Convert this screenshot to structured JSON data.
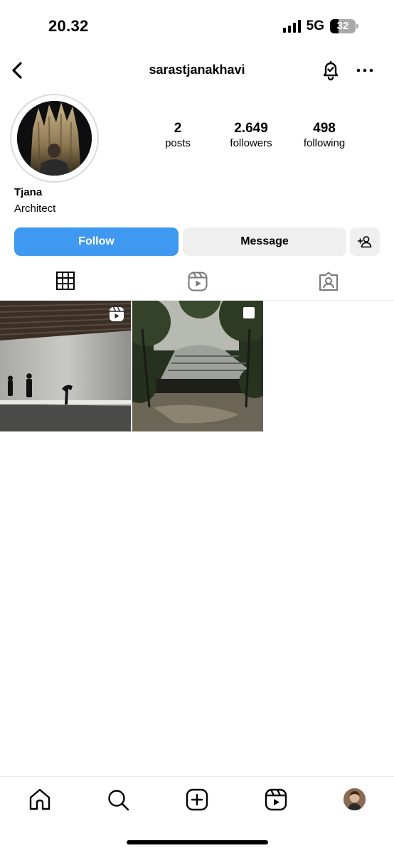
{
  "status_bar": {
    "time": "20.32",
    "network": "5G",
    "battery_level": "32",
    "battery_fraction": 0.32,
    "signal_bars": 4
  },
  "nav": {
    "username": "sarastjanakhavi",
    "back_icon": "chevron-left-icon",
    "bell_icon": "bell-check-icon",
    "more_icon": "more-horizontal-icon"
  },
  "profile": {
    "stats": [
      {
        "value": "2",
        "label": "posts"
      },
      {
        "value": "2.649",
        "label": "followers"
      },
      {
        "value": "498",
        "label": "following"
      }
    ],
    "name": "Tjana",
    "bio": "Architect"
  },
  "actions": {
    "follow_label": "Follow",
    "message_label": "Message",
    "add_user_icon": "add-user-icon",
    "follow_color": "#4099f0"
  },
  "tabs": [
    {
      "icon": "grid-icon",
      "active": true
    },
    {
      "icon": "reels-icon",
      "active": false
    },
    {
      "icon": "tagged-icon",
      "active": false
    }
  ],
  "posts": [
    {
      "type": "reel",
      "badge_icon": "reels-icon"
    },
    {
      "type": "carousel",
      "badge_icon": "carousel-icon"
    }
  ],
  "bottom_nav": [
    {
      "icon": "home-icon"
    },
    {
      "icon": "search-icon"
    },
    {
      "icon": "create-icon"
    },
    {
      "icon": "reels-icon"
    },
    {
      "icon": "profile-avatar"
    }
  ]
}
